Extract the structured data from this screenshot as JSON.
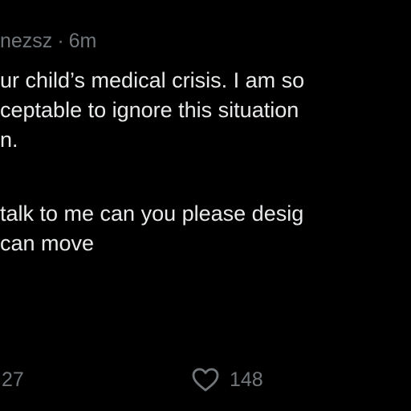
{
  "post": {
    "handle_fragment": "nezsz",
    "separator": "·",
    "time": "6m",
    "lines": [
      "ur child’s medical crisis.  I am so",
      "ceptable to ignore this situation",
      "n.",
      "talk to me can you please desig",
      "can move"
    ]
  },
  "actions": {
    "reply_count": "27",
    "like_count": "148",
    "reply_icon": "reply-icon",
    "like_icon": "heart-icon"
  },
  "colors": {
    "background": "#000000",
    "text": "#e7e9ea",
    "muted": "#71767b"
  }
}
